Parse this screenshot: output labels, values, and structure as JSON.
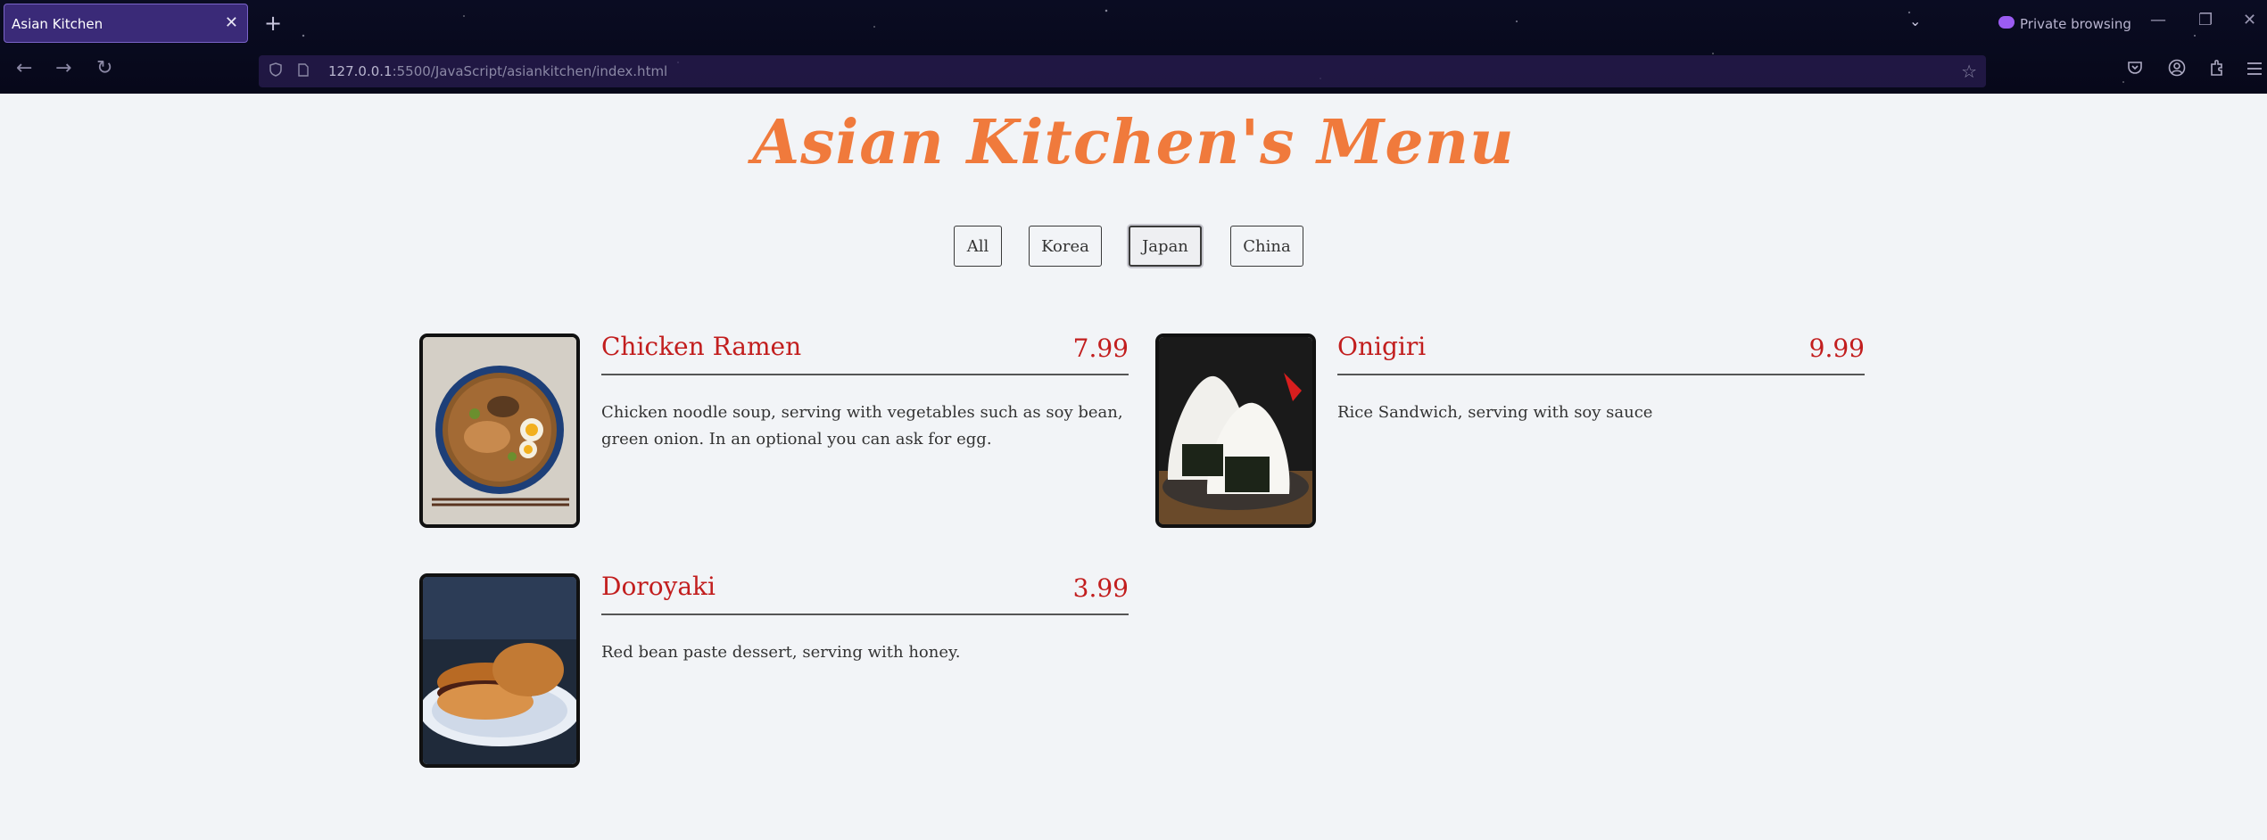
{
  "browser": {
    "tab_title": "Asian Kitchen",
    "tab_close": "✕",
    "new_tab": "+",
    "tabs_list": "⌄",
    "private_label": "Private browsing",
    "url_host": "127.0.0.1",
    "url_rest": ":5500/JavaScript/asiankitchen/index.html",
    "back": "←",
    "forward": "→",
    "reload": "↻",
    "minimize": "—",
    "restore": "❐",
    "close": "✕",
    "icons": [
      "shield-icon",
      "page-icon",
      "star-icon",
      "pocket-icon",
      "account-icon",
      "extensions-icon",
      "menu-icon"
    ]
  },
  "page": {
    "title": "Asian Kitchen's Menu",
    "filters": [
      {
        "label": "All",
        "active": false
      },
      {
        "label": "Korea",
        "active": false
      },
      {
        "label": "Japan",
        "active": true
      },
      {
        "label": "China",
        "active": false
      }
    ],
    "items": [
      {
        "name": "Chicken Ramen",
        "price": "7.99",
        "desc": "Chicken noodle soup, serving with vegetables such as soy bean, green onion. In an optional you can ask for egg.",
        "image": "ramen-photo"
      },
      {
        "name": "Onigiri",
        "price": "9.99",
        "desc": "Rice Sandwich, serving with soy sauce",
        "image": "onigiri-photo"
      },
      {
        "name": "Doroyaki",
        "price": "3.99",
        "desc": "Red bean paste dessert, serving with honey.",
        "image": "dorayaki-photo"
      }
    ]
  },
  "colors": {
    "title": "#f07a3c",
    "item_text": "#c21e1e",
    "page_bg": "#f2f4f7"
  }
}
